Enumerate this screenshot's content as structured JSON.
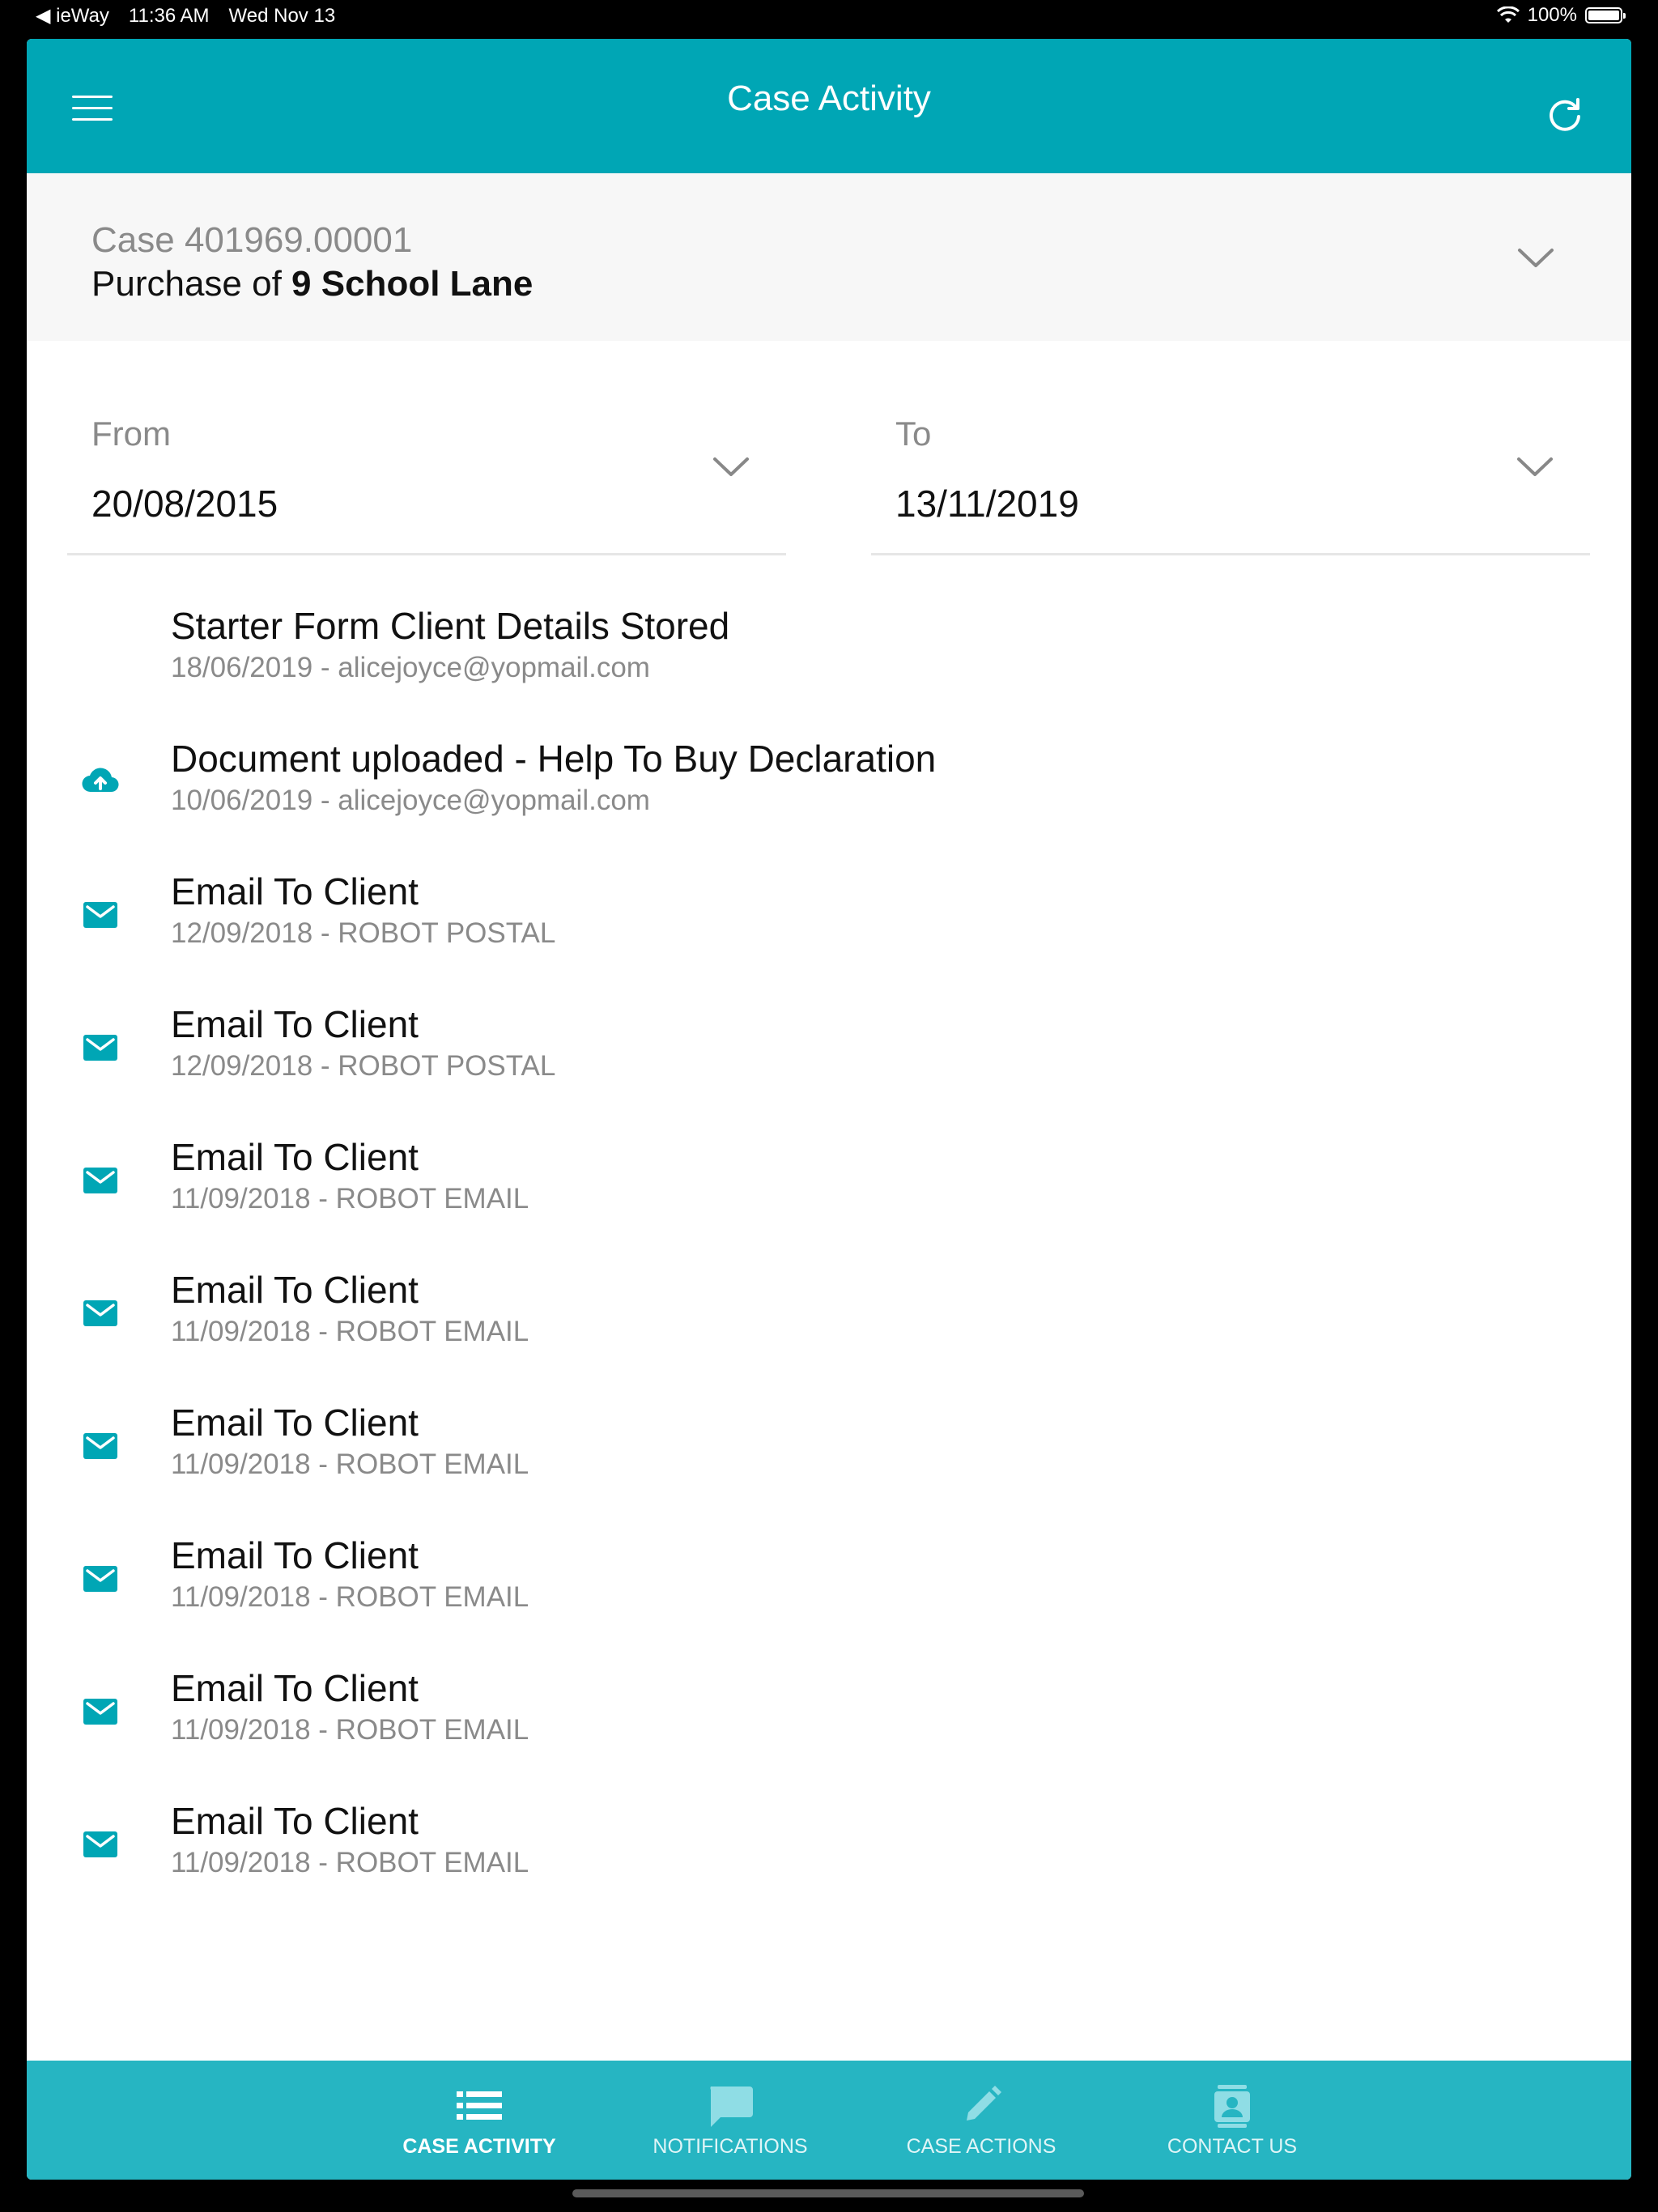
{
  "status_bar": {
    "back_app": "◀ ieWay",
    "time": "11:36 AM",
    "date": "Wed Nov 13",
    "battery": "100%"
  },
  "header": {
    "title": "Case Activity",
    "menu_icon": "hamburger-icon",
    "refresh_icon": "refresh-icon"
  },
  "case": {
    "number": "Case 401969.00001",
    "description_prefix": "Purchase of",
    "description_property": "9 School Lane"
  },
  "filters": {
    "from": {
      "label": "From",
      "value": "20/08/2015"
    },
    "to": {
      "label": "To",
      "value": "13/11/2019"
    }
  },
  "activities": [
    {
      "icon": "none",
      "title": "Starter Form Client Details Stored",
      "subtitle": "18/06/2019 - alicejoyce@yopmail.com"
    },
    {
      "icon": "cloud-upload-icon",
      "title": "Document uploaded - Help To Buy Declaration",
      "subtitle": "10/06/2019 - alicejoyce@yopmail.com"
    },
    {
      "icon": "mail-icon",
      "title": "Email To Client",
      "subtitle": "12/09/2018 - ROBOT POSTAL"
    },
    {
      "icon": "mail-icon",
      "title": "Email To Client",
      "subtitle": "12/09/2018 - ROBOT POSTAL"
    },
    {
      "icon": "mail-icon",
      "title": "Email To Client",
      "subtitle": "11/09/2018 - ROBOT EMAIL"
    },
    {
      "icon": "mail-icon",
      "title": "Email To Client",
      "subtitle": "11/09/2018 - ROBOT EMAIL"
    },
    {
      "icon": "mail-icon",
      "title": "Email To Client",
      "subtitle": "11/09/2018 - ROBOT EMAIL"
    },
    {
      "icon": "mail-icon",
      "title": "Email To Client",
      "subtitle": "11/09/2018 - ROBOT EMAIL"
    },
    {
      "icon": "mail-icon",
      "title": "Email To Client",
      "subtitle": "11/09/2018 - ROBOT EMAIL"
    },
    {
      "icon": "mail-icon",
      "title": "Email To Client",
      "subtitle": "11/09/2018 - ROBOT EMAIL"
    }
  ],
  "tabs": [
    {
      "label": "CASE ACTIVITY",
      "icon": "list-icon",
      "active": true
    },
    {
      "label": "NOTIFICATIONS",
      "icon": "chat-bubble-icon",
      "active": false
    },
    {
      "label": "CASE ACTIONS",
      "icon": "pencil-icon",
      "active": false
    },
    {
      "label": "CONTACT US",
      "icon": "contact-card-icon",
      "active": false
    }
  ],
  "colors": {
    "primary": "#00a6b5",
    "tabbar": "#26b5c2",
    "icon": "#00a6b5",
    "muted_text": "#8a8a8a"
  }
}
